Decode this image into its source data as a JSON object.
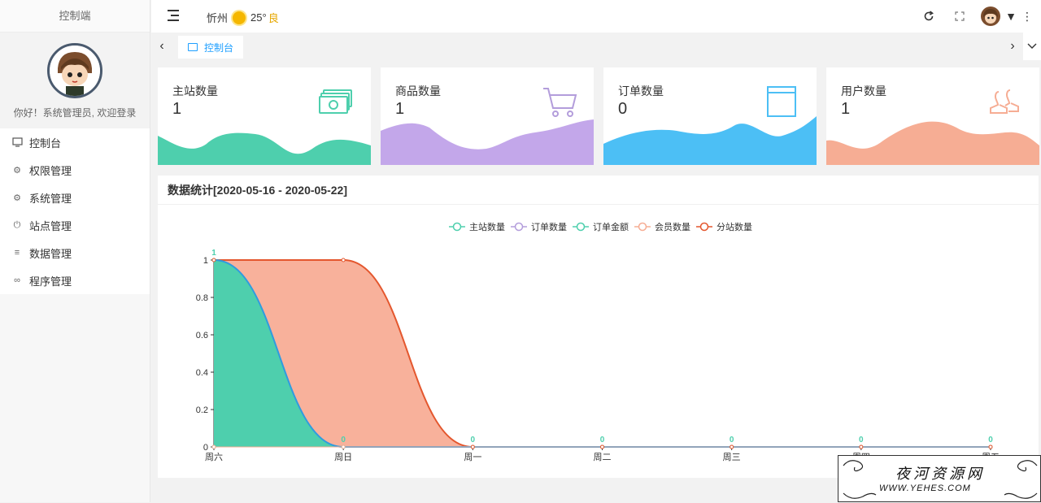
{
  "sidebar": {
    "brand": "控制端",
    "welcome": "你好！系统管理员, 欢迎登录",
    "items": [
      {
        "label": "控制台",
        "icon": "monitor-icon"
      },
      {
        "label": "权限管理",
        "icon": "gear-icon"
      },
      {
        "label": "系统管理",
        "icon": "gear-icon"
      },
      {
        "label": "站点管理",
        "icon": "power-icon"
      },
      {
        "label": "数据管理",
        "icon": "list-icon"
      },
      {
        "label": "程序管理",
        "icon": "link-icon"
      }
    ]
  },
  "header": {
    "city": "忻州",
    "temperature": "25°",
    "air_quality": "良",
    "icons": [
      "refresh-icon",
      "fullscreen-icon",
      "avatar",
      "caret-down-icon",
      "more-vertical-icon"
    ]
  },
  "tabs": {
    "active": "控制台",
    "prev_icon": "chevron-left-icon",
    "next_icon": "chevron-right-icon",
    "dropdown_icon": "chevron-down-icon"
  },
  "cards": [
    {
      "title": "主站数量",
      "value": "1",
      "color": "#4ecfad",
      "icon": "money-icon"
    },
    {
      "title": "商品数量",
      "value": "1",
      "color": "#c3a7ea",
      "icon": "cart-icon"
    },
    {
      "title": "订单数量",
      "value": "0",
      "color": "#4cbff5",
      "icon": "window-icon"
    },
    {
      "title": "用户数量",
      "value": "1",
      "color": "#f6ad94",
      "icon": "users-icon"
    }
  ],
  "panel": {
    "title": "数据统计[2020-05-16 - 2020-05-22]"
  },
  "chart_data": {
    "type": "area",
    "categories": [
      "周六",
      "周日",
      "周一",
      "周二",
      "周三",
      "周四",
      "周五"
    ],
    "ylim": [
      0,
      1
    ],
    "yticks": [
      "0",
      "0.2",
      "0.4",
      "0.6",
      "0.8",
      "1"
    ],
    "legend_position": "top-center",
    "series": [
      {
        "name": "主站数量",
        "color": "#4ecfad",
        "values": [
          1,
          0,
          0,
          0,
          0,
          0,
          0
        ]
      },
      {
        "name": "订单数量",
        "color": "#b39ddb",
        "values": [
          0,
          0,
          0,
          0,
          0,
          0,
          0
        ]
      },
      {
        "name": "订单金额",
        "color": "#4ecfad",
        "values": [
          0,
          0,
          0,
          0,
          0,
          0,
          0
        ]
      },
      {
        "name": "会员数量",
        "color": "#f6ad94",
        "values": [
          0,
          0,
          0,
          0,
          0,
          0,
          0
        ]
      },
      {
        "name": "分站数量",
        "color": "#e4572e",
        "values": [
          1,
          1,
          0,
          0,
          0,
          0,
          0
        ]
      }
    ],
    "data_labels": [
      "1",
      "0",
      "0",
      "0",
      "0",
      "0",
      "0"
    ]
  },
  "watermark": {
    "title": "夜河资源网",
    "url": "WWW.YEHES.COM"
  }
}
